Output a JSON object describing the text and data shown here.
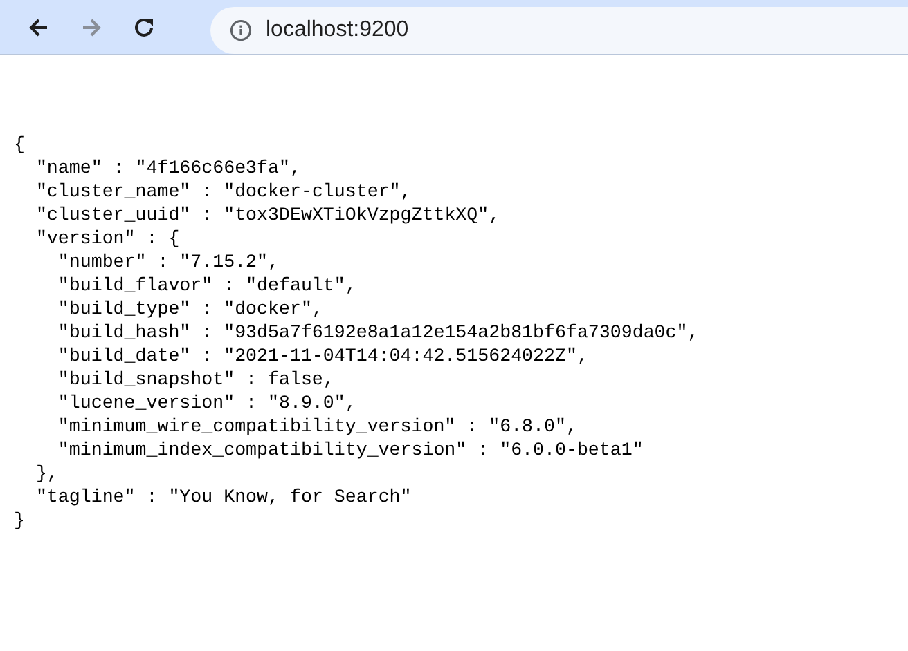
{
  "toolbar": {
    "buttons": [
      {
        "kind": "back",
        "disabled": false
      },
      {
        "kind": "forward",
        "disabled": true
      },
      {
        "kind": "reload",
        "disabled": false
      }
    ],
    "address": "localhost:9200"
  },
  "document": {
    "lines": [
      {
        "text": "{",
        "children": [
          {
            "text": "\"name\" : \"4f166c66e3fa\","
          },
          {
            "text": "\"cluster_name\" : \"docker-cluster\","
          },
          {
            "text": "\"cluster_uuid\" : \"tox3DEwXTiOkVzpgZttkXQ\","
          },
          {
            "text": "\"version\" : {",
            "children": [
              {
                "text": "\"number\" : \"7.15.2\","
              },
              {
                "text": "\"build_flavor\" : \"default\","
              },
              {
                "text": "\"build_type\" : \"docker\","
              },
              {
                "text": "\"build_hash\" : \"93d5a7f6192e8a1a12e154a2b81bf6fa7309da0c\","
              },
              {
                "text": "\"build_date\" : \"2021-11-04T14:04:42.515624022Z\","
              },
              {
                "text": "\"build_snapshot\" : false,"
              },
              {
                "text": "\"lucene_version\" : \"8.9.0\","
              },
              {
                "text": "\"minimum_wire_compatibility_version\" : \"6.8.0\","
              },
              {
                "text": "\"minimum_index_compatibility_version\" : \"6.0.0-beta1\""
              }
            ]
          },
          {
            "text": "},"
          },
          {
            "text": "\"tagline\" : \"You Know, for Search\""
          }
        ]
      },
      {
        "text": "}"
      }
    ]
  }
}
